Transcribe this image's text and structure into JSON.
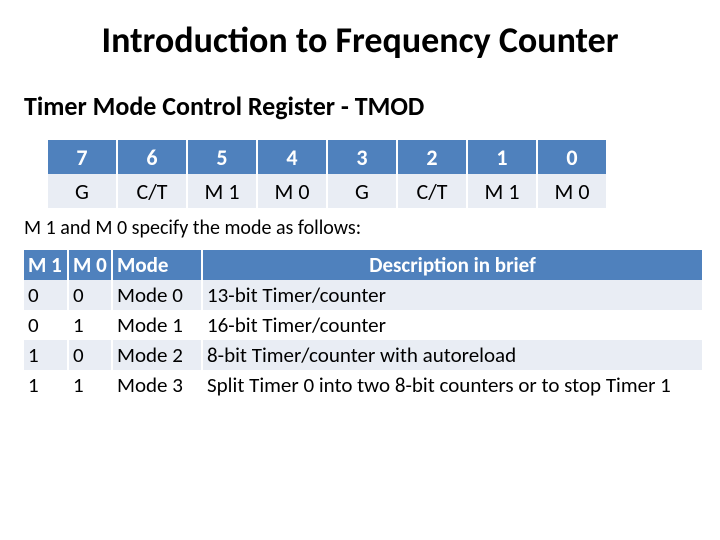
{
  "title": "Introduction to Frequency Counter",
  "subtitle": "Timer Mode Control Register - TMOD",
  "bit_table": {
    "bits": [
      "7",
      "6",
      "5",
      "4",
      "3",
      "2",
      "1",
      "0"
    ],
    "fields": [
      "G",
      "C/T",
      "M 1",
      "M 0",
      "G",
      "C/T",
      "M 1",
      "M 0"
    ]
  },
  "note": "M 1 and M 0 specify the mode as follows:",
  "mode_table": {
    "headers": {
      "m1": "M 1",
      "m0": "M 0",
      "mode": "Mode",
      "desc": "Description in brief"
    },
    "rows": [
      {
        "m1": "0",
        "m0": "0",
        "mode": "Mode 0",
        "desc": "13-bit Timer/counter"
      },
      {
        "m1": "0",
        "m0": "1",
        "mode": "Mode 1",
        "desc": "16-bit Timer/counter"
      },
      {
        "m1": "1",
        "m0": "0",
        "mode": "Mode 2",
        "desc": "8-bit Timer/counter with autoreload"
      },
      {
        "m1": "1",
        "m0": "1",
        "mode": "Mode 3",
        "desc": "Split Timer 0 into two 8-bit counters or to stop Timer 1"
      }
    ]
  }
}
